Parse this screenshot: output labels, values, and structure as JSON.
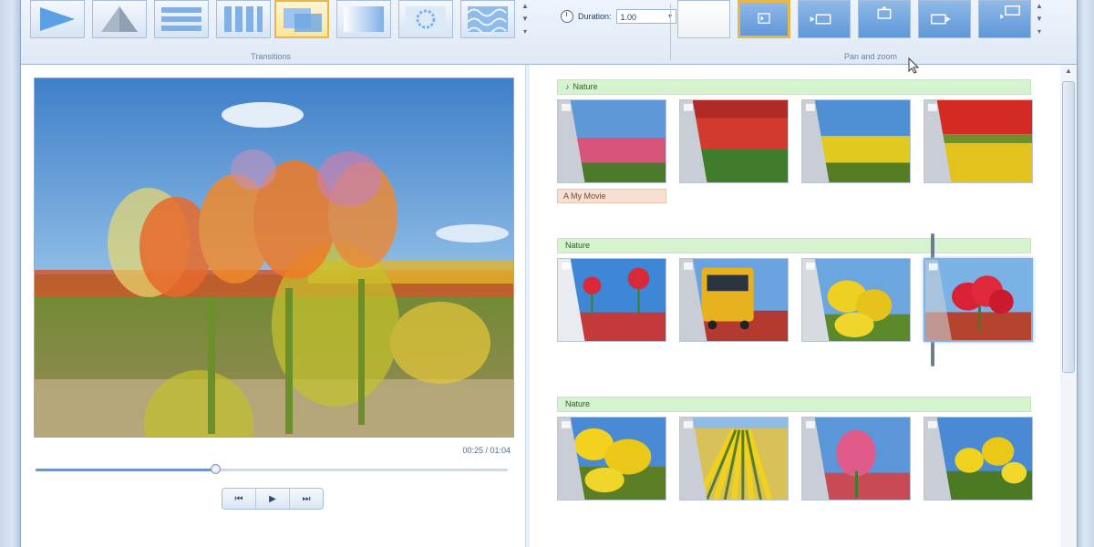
{
  "ribbon": {
    "transitions_label": "Transitions",
    "duration_label": "Duration:",
    "duration_value": "1.00",
    "pan_zoom_label": "Pan and zoom",
    "transitions": [
      {
        "icon": "slide-right-icon"
      },
      {
        "icon": "triangle-reveal-icon"
      },
      {
        "icon": "horizontal-bars-icon"
      },
      {
        "icon": "vertical-bars-icon"
      },
      {
        "icon": "crossfade-icon",
        "selected": true
      },
      {
        "icon": "fade-icon"
      },
      {
        "icon": "pixelate-icon"
      },
      {
        "icon": "pattern-icon"
      }
    ],
    "pan_zoom": [
      {
        "icon": "none-icon"
      },
      {
        "icon": "zoom-in-center-icon",
        "selected": true
      },
      {
        "icon": "pan-left-icon"
      },
      {
        "icon": "pan-up-icon"
      },
      {
        "icon": "pan-right-icon"
      },
      {
        "icon": "zoom-out-icon"
      }
    ]
  },
  "preview": {
    "timecode": "00:25 / 01:04",
    "progress": 0.38
  },
  "storyboard": {
    "groups": [
      {
        "music": "Nature",
        "title": "My Movie"
      },
      {
        "music": "Nature"
      },
      {
        "music": "Nature"
      }
    ]
  },
  "colors": {
    "music_bar": "#d6f3cf",
    "title_chip": "#f7dfd1",
    "selection": "#e6b74a"
  }
}
